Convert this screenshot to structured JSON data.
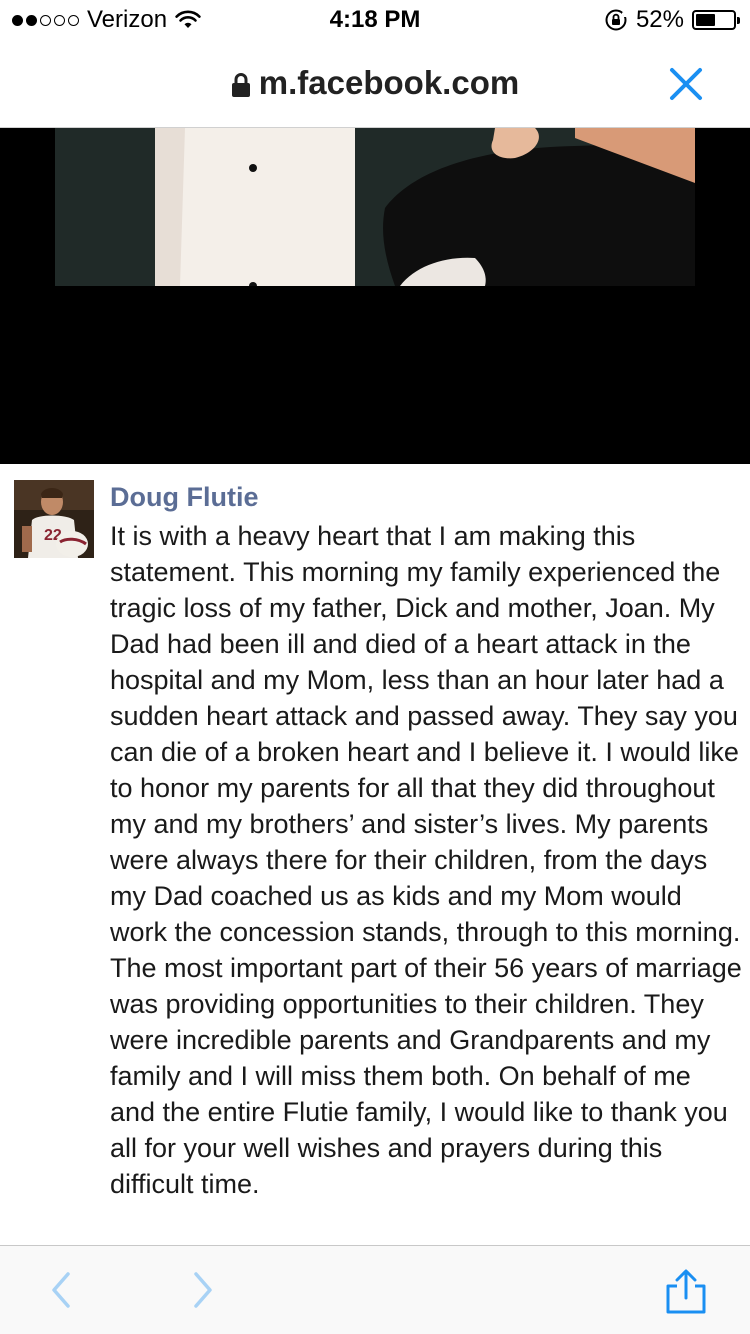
{
  "status_bar": {
    "carrier": "Verizon",
    "time": "4:18 PM",
    "battery": "52%",
    "battery_level": 0.52,
    "signal_bars_filled": 2,
    "signal_bars_total": 5
  },
  "browser": {
    "url": "m.facebook.com"
  },
  "post": {
    "author": "Doug Flutie",
    "text": "It is with a heavy heart that I am making this statement. This morning my family experienced the tragic loss of my father, Dick and mother, Joan. My Dad had been ill and died of a heart attack in the hospital and my Mom, less than an hour later had a sudden heart attack and passed away. They say you can die of a broken heart and I believe it. I would like to honor my parents for all that they did throughout my and my brothers’ and sister’s lives. My parents were always there for their children, from the days my Dad coached us as kids and my Mom would work the concession stands, through to this morning. The most important part of their 56 years of marriage was providing opportunities to their children. They were incredible parents and Grandparents and my family and I will miss them both. On behalf of me and the entire Flutie family, I would like to thank you all for your well wishes and prayers during this difficult time."
  },
  "colors": {
    "accent": "#1a8ff2",
    "author_name": "#5b6d95",
    "disabled_nav": "#a8d2f5"
  },
  "icons": {
    "close": "close-icon",
    "lock": "lock-icon",
    "back": "chevron-left-icon",
    "forward": "chevron-right-icon",
    "share": "share-icon"
  }
}
